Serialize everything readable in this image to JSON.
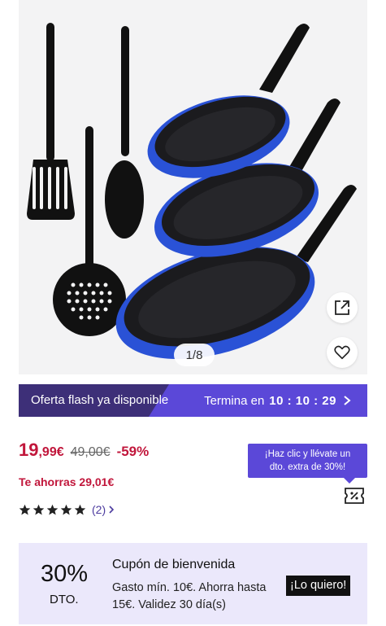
{
  "gallery": {
    "image_alt": "Set de sartenes y utensilios",
    "counter": "1/8",
    "share_icon": "external-link-icon",
    "favorite_icon": "heart-icon"
  },
  "flash": {
    "label": "Oferta flash ya disponible",
    "ends_label": "Termina en",
    "time": "10 : 10 : 29",
    "colors": {
      "left": "#3d2f78",
      "right": "#5b48d8"
    }
  },
  "price": {
    "integer": "19",
    "decimal": ",99€",
    "old": "49,00€",
    "discount": "-59%",
    "savings": "Te ahorras 29,01€"
  },
  "rating": {
    "stars": 5,
    "count": "(2)"
  },
  "extra_discount_tip": {
    "line1": "¡Haz clic y llévate un",
    "line2": "dto. extra de 30%!"
  },
  "coupon": {
    "percent": "30%",
    "dto": "DTO.",
    "title": "Cupón de bienvenida",
    "description": "Gasto mín. 10€. Ahorra hasta 15€. Validez 30 día(s)",
    "cta": "¡Lo quiero!",
    "background": "#ebe8fb"
  },
  "accent_color": "#c1163b"
}
